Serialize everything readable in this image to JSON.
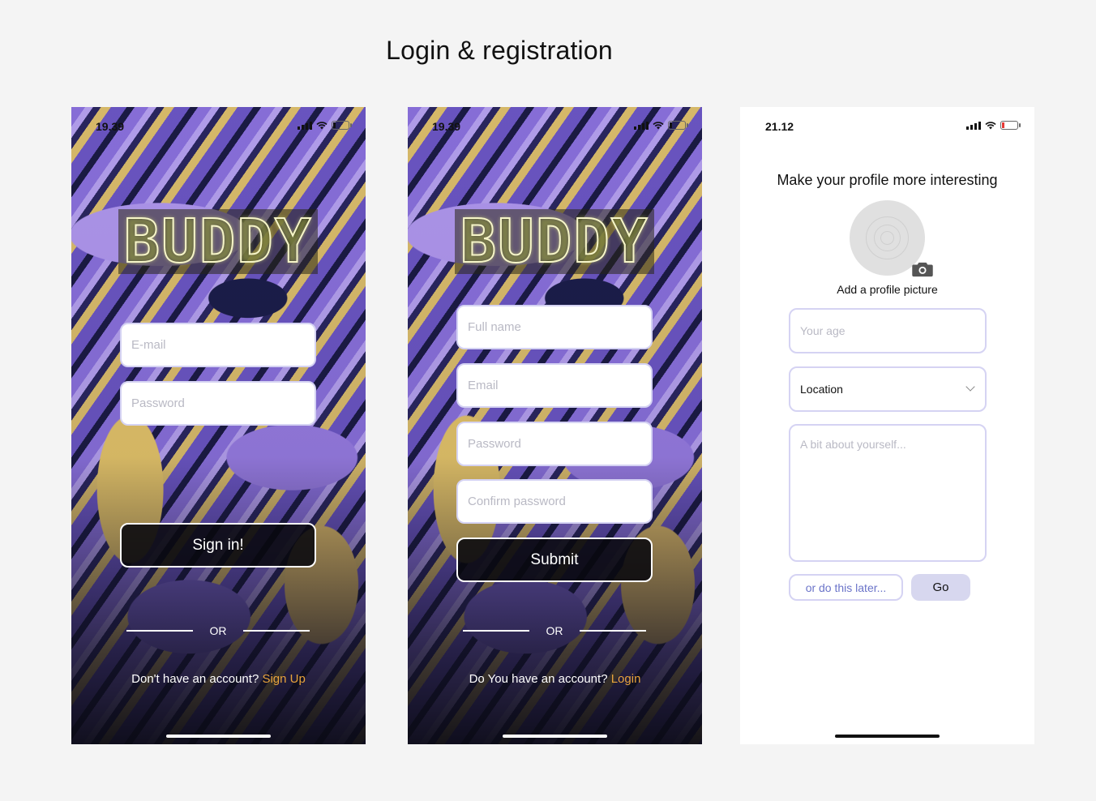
{
  "page": {
    "title": "Login & registration"
  },
  "login": {
    "status_time": "19.39",
    "logo": "BUDDY",
    "email_placeholder": "E-mail",
    "password_placeholder": "Password",
    "sign_in_label": "Sign in!",
    "or_label": "OR",
    "footer_prompt": "Don't have an account?",
    "footer_link": "Sign Up"
  },
  "signup": {
    "status_time": "19.39",
    "logo": "BUDDY",
    "full_name_placeholder": "Full name",
    "email_placeholder": "Email",
    "password_placeholder": "Password",
    "confirm_password_placeholder": "Confirm password",
    "submit_label": "Submit",
    "or_label": "OR",
    "footer_prompt": "Do You have an account?",
    "footer_link": "Login"
  },
  "profile": {
    "status_time": "21.12",
    "heading": "Make your profile more interesting",
    "avatar_caption": "Add a profile picture",
    "age_placeholder": "Your age",
    "location_value": "Location",
    "about_placeholder": "A bit about yourself...",
    "later_label": "or do this later...",
    "go_label": "Go"
  },
  "colors": {
    "accent_link": "#e8a33c",
    "field_border": "#d5d3f3",
    "go_button": "#d7d7ef",
    "later_text": "#6b74c9"
  }
}
